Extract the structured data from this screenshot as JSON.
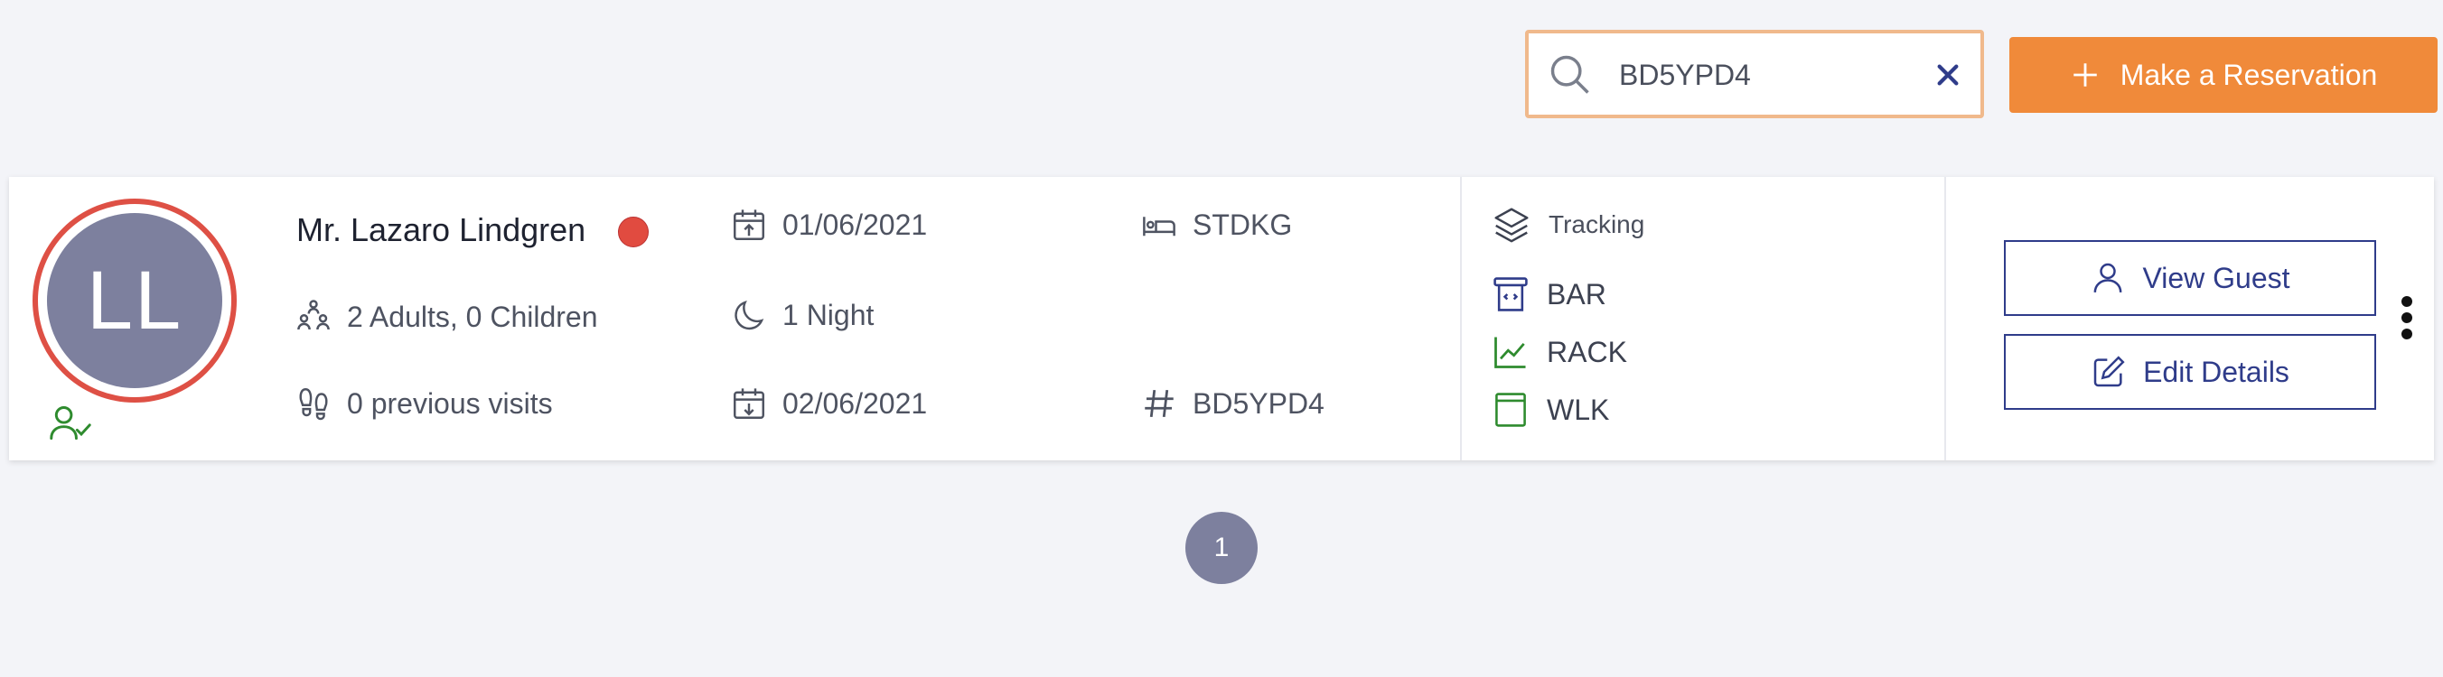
{
  "search": {
    "value": "BD5YPD4",
    "placeholder": ""
  },
  "toolbar": {
    "make_reservation_label": "Make a Reservation"
  },
  "colors": {
    "accent": "#f08a3a",
    "primary": "#2f3c8a",
    "avatar": "#7d809e",
    "vip": "#e14b40",
    "green": "#2e8b2e"
  },
  "reservation": {
    "avatar_initials": "LL",
    "guest_name": "Mr. Lazaro Lindgren",
    "occupancy": "2 Adults, 0 Children",
    "previous_visits": "0 previous visits",
    "arrival_date": "01/06/2021",
    "nights": "1 Night",
    "departure_date": "02/06/2021",
    "room_type": "STDKG",
    "confirmation": "BD5YPD4",
    "tracking_label": "Tracking",
    "rate_codes": [
      "BAR",
      "RACK",
      "WLK"
    ],
    "view_guest_label": "View Guest",
    "edit_details_label": "Edit Details"
  },
  "pagination": {
    "current_page": "1"
  }
}
